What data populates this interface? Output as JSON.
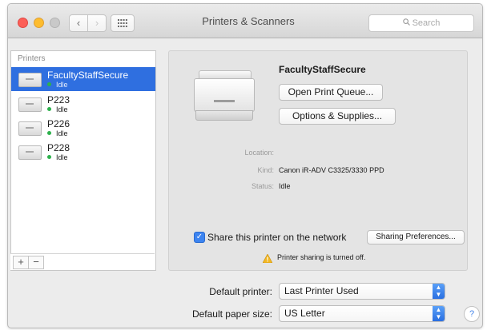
{
  "window": {
    "title": "Printers & Scanners"
  },
  "toolbar": {
    "back_icon": "chevron-left-icon",
    "forward_icon": "chevron-right-icon",
    "grid_icon": "grid-icon",
    "search_placeholder": "Search"
  },
  "printers": {
    "header": "Printers",
    "items": [
      {
        "name": "FacultyStaffSecure",
        "status": "Idle",
        "selected": true
      },
      {
        "name": "P223",
        "status": "Idle",
        "selected": false
      },
      {
        "name": "P226",
        "status": "Idle",
        "selected": false
      },
      {
        "name": "P228",
        "status": "Idle",
        "selected": false
      }
    ],
    "add_label": "+",
    "remove_label": "−"
  },
  "detail": {
    "name": "FacultyStaffSecure",
    "open_queue_label": "Open Print Queue...",
    "options_label": "Options & Supplies...",
    "location_label": "Location:",
    "location_value": "",
    "kind_label": "Kind:",
    "kind_value": "Canon iR-ADV C3325/3330 PPD",
    "status_label": "Status:",
    "status_value": "Idle",
    "share_label": "Share this printer on the network",
    "share_checked": true,
    "sharing_prefs_label": "Sharing Preferences...",
    "sharing_off_text": "Printer sharing is turned off."
  },
  "defaults": {
    "printer_label": "Default printer:",
    "printer_value": "Last Printer Used",
    "paper_label": "Default paper size:",
    "paper_value": "US Letter",
    "help_label": "?"
  },
  "colors": {
    "selection": "#2f6fe0",
    "idle_dot": "#2db14c",
    "accent": "#3d84f0"
  }
}
